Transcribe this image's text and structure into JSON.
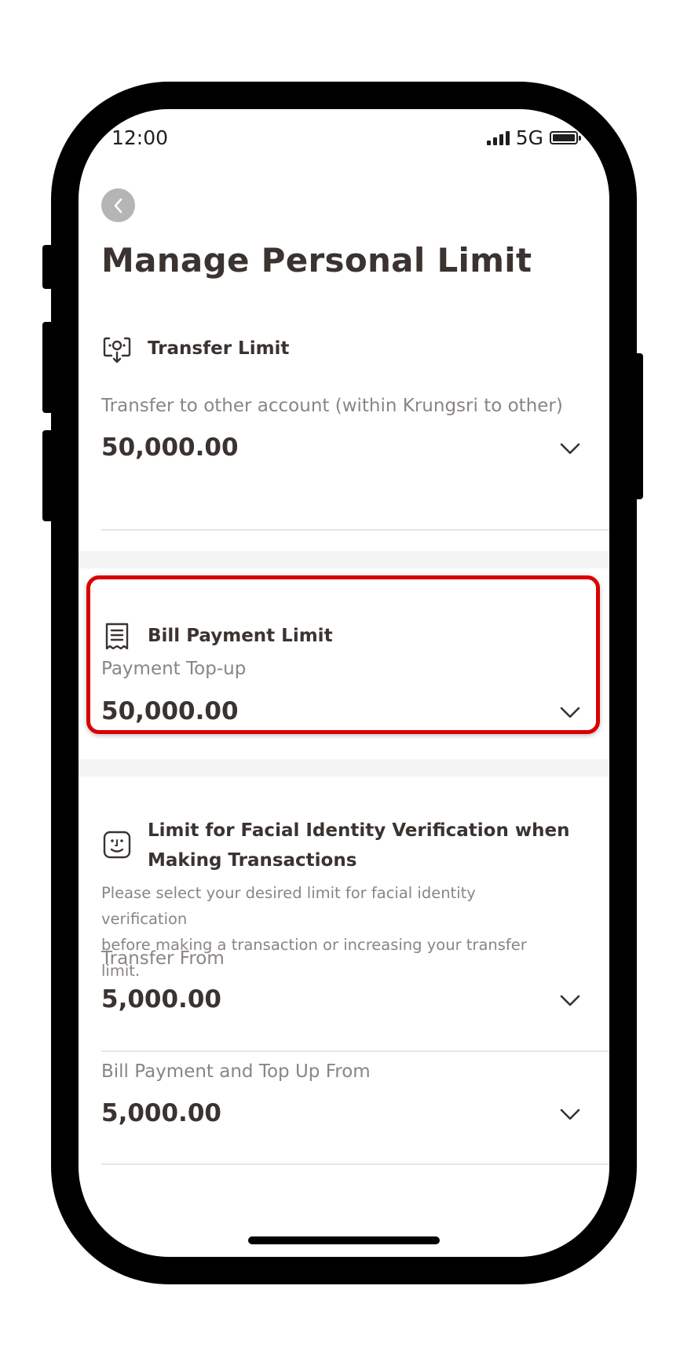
{
  "status_bar": {
    "time": "12:00",
    "network": "5G"
  },
  "header": {
    "title": "Manage Personal Limit"
  },
  "transfer_limit": {
    "title": "Transfer Limit",
    "label": "Transfer to other account (within Krungsri to other)",
    "value": "50,000.00"
  },
  "bill_payment_limit": {
    "title": "Bill Payment Limit",
    "label": "Payment Top-up",
    "value": "50,000.00"
  },
  "facial_limit": {
    "title_line1": "Limit for Facial Identity Verification when",
    "title_line2": "Making Transactions",
    "description_line1": "Please select your desired limit for facial identity verification",
    "description_line2": "before making a transaction or increasing your transfer limit.",
    "fields": [
      {
        "label": "Transfer From",
        "value": "5,000.00"
      },
      {
        "label": "Bill Payment and Top Up From",
        "value": "5,000.00"
      }
    ]
  },
  "colors": {
    "highlight": "#d90000",
    "text": "#3a3330",
    "muted": "#8a8584"
  }
}
